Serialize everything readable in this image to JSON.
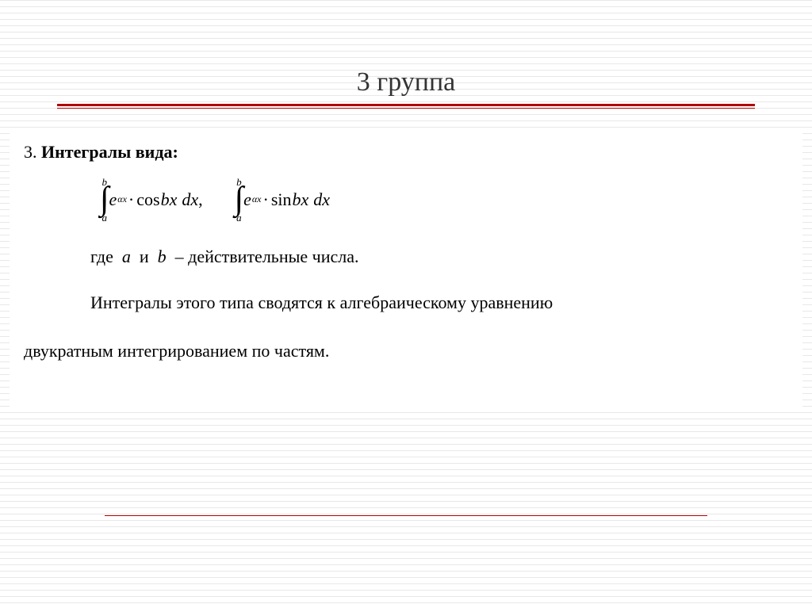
{
  "title": "3 группа",
  "heading_number": "3.",
  "heading_text": "Интегралы вида:",
  "formula": {
    "upper_limit": "b",
    "lower_limit": "a",
    "e_base": "e",
    "e_exp": "αx",
    "fn_cos": "cos",
    "fn_sin": "sin",
    "bx": "bx",
    "dx": "dx",
    "comma": ","
  },
  "where": {
    "prefix": "где",
    "a": "a",
    "and": "и",
    "b": "b",
    "suffix": "– действительные числа."
  },
  "body_line1": "Интегралы этого типа сводятся к алгебраическому уравнению",
  "body_line2": "двукратным интегрированием по частям."
}
